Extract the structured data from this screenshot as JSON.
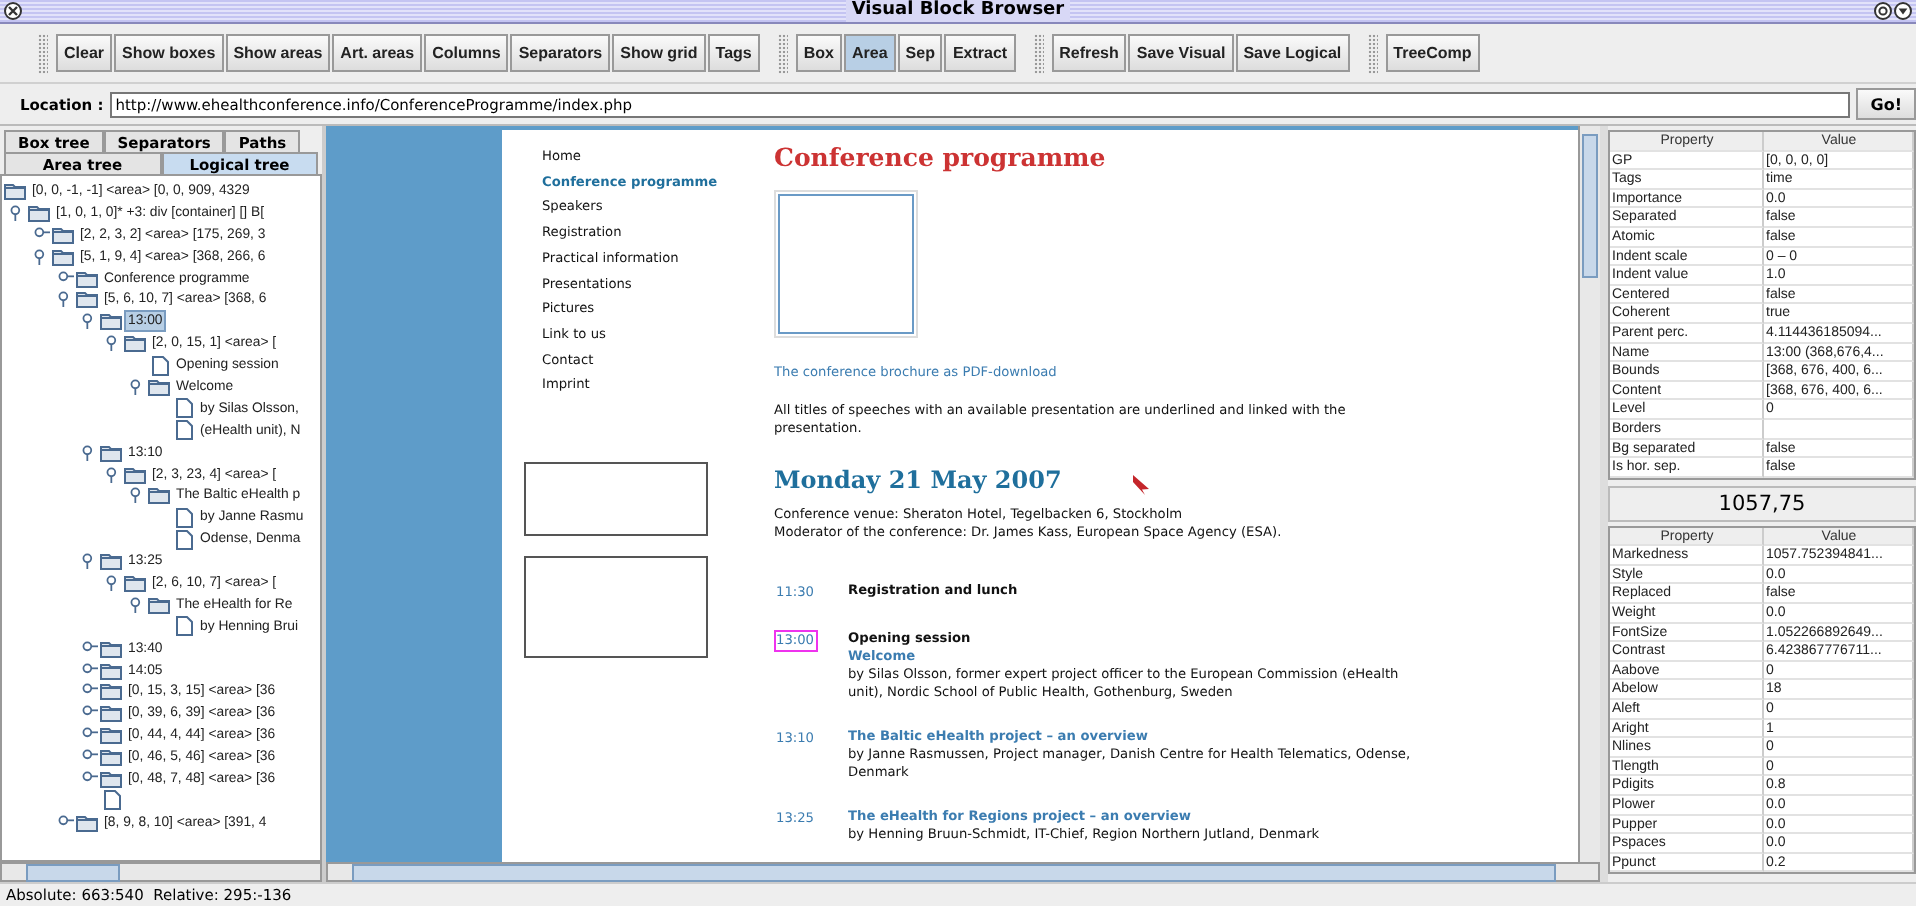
{
  "window": {
    "title": "Visual Block Browser"
  },
  "toolbar": {
    "groups": [
      {
        "buttons": [
          {
            "label": "Clear",
            "selected": false
          },
          {
            "label": "Show boxes",
            "selected": false
          },
          {
            "label": "Show areas",
            "selected": false
          },
          {
            "label": "Art. areas",
            "selected": false
          },
          {
            "label": "Columns",
            "selected": false
          },
          {
            "label": "Separators",
            "selected": false
          },
          {
            "label": "Show grid",
            "selected": false
          },
          {
            "label": "Tags",
            "selected": false
          }
        ]
      },
      {
        "buttons": [
          {
            "label": "Box",
            "selected": false
          },
          {
            "label": "Area",
            "selected": true
          },
          {
            "label": "Sep",
            "selected": false
          },
          {
            "label": "Extract",
            "selected": false
          }
        ]
      },
      {
        "buttons": [
          {
            "label": "Refresh",
            "selected": false
          },
          {
            "label": "Save Visual",
            "selected": false
          },
          {
            "label": "Save Logical",
            "selected": false
          }
        ]
      },
      {
        "buttons": [
          {
            "label": "TreeComp",
            "selected": false
          }
        ]
      }
    ]
  },
  "location": {
    "label": "Location :",
    "value": "http://www.ehealthconference.info/ConferenceProgramme/index.php",
    "go": "Go!"
  },
  "left_panel": {
    "tab_rows": [
      [
        {
          "label": "Box tree",
          "selected": false
        },
        {
          "label": "Separators",
          "selected": false
        },
        {
          "label": "Paths",
          "selected": false
        }
      ],
      [
        {
          "label": "Area tree",
          "selected": false
        },
        {
          "label": "Logical tree",
          "selected": true
        }
      ]
    ],
    "tree": [
      {
        "label": "[0, 0, -1, -1] <area> [0, 0, 909, 4329",
        "kind": "folder",
        "expanded": true,
        "selected": false,
        "children": [
          {
            "label": "[1, 0, 1, 0]* +3: div [container] [] B[",
            "kind": "folder",
            "expanded": true,
            "selected": false,
            "children": [
              {
                "label": "[2, 2, 3, 2] <area> [175, 269, 3",
                "kind": "folder",
                "expanded": false,
                "selected": false
              },
              {
                "label": "[5, 1, 9, 4] <area> [368, 266, 6",
                "kind": "folder",
                "expanded": true,
                "selected": false,
                "children": [
                  {
                    "label": "Conference programme",
                    "kind": "folder",
                    "expanded": false,
                    "selected": false
                  },
                  {
                    "label": "[5, 6, 10, 7] <area> [368, 6",
                    "kind": "folder",
                    "expanded": true,
                    "selected": false,
                    "children": [
                      {
                        "label": "13:00",
                        "kind": "folder",
                        "expanded": true,
                        "selected": true,
                        "children": [
                          {
                            "label": "[2, 0, 15, 1] <area> [",
                            "kind": "folder",
                            "expanded": true,
                            "selected": false,
                            "children": [
                              {
                                "label": "Opening session",
                                "kind": "leaf",
                                "selected": false
                              },
                              {
                                "label": "Welcome",
                                "kind": "folder",
                                "expanded": true,
                                "selected": false,
                                "children": [
                                  {
                                    "label": "by Silas Olsson,",
                                    "kind": "leaf",
                                    "selected": false
                                  },
                                  {
                                    "label": "(eHealth unit), N",
                                    "kind": "leaf",
                                    "selected": false
                                  }
                                ]
                              }
                            ]
                          }
                        ]
                      },
                      {
                        "label": "13:10",
                        "kind": "folder",
                        "expanded": true,
                        "selected": false,
                        "children": [
                          {
                            "label": "[2, 3, 23, 4] <area> [",
                            "kind": "folder",
                            "expanded": true,
                            "selected": false,
                            "children": [
                              {
                                "label": "The Baltic eHealth p",
                                "kind": "folder",
                                "expanded": true,
                                "selected": false,
                                "children": [
                                  {
                                    "label": "by Janne Rasmu",
                                    "kind": "leaf",
                                    "selected": false
                                  },
                                  {
                                    "label": "Odense, Denma",
                                    "kind": "leaf",
                                    "selected": false
                                  }
                                ]
                              }
                            ]
                          }
                        ]
                      },
                      {
                        "label": "13:25",
                        "kind": "folder",
                        "expanded": true,
                        "selected": false,
                        "children": [
                          {
                            "label": "[2, 6, 10, 7] <area> [",
                            "kind": "folder",
                            "expanded": true,
                            "selected": false,
                            "children": [
                              {
                                "label": "The eHealth for Re",
                                "kind": "folder",
                                "expanded": true,
                                "selected": false,
                                "children": [
                                  {
                                    "label": "by Henning Brui",
                                    "kind": "leaf",
                                    "selected": false
                                  }
                                ]
                              }
                            ]
                          }
                        ]
                      },
                      {
                        "label": "13:40",
                        "kind": "folder",
                        "expanded": false,
                        "selected": false
                      },
                      {
                        "label": "14:05",
                        "kind": "folder",
                        "expanded": false,
                        "selected": false
                      },
                      {
                        "label": "[0, 15, 3, 15] <area> [36",
                        "kind": "folder",
                        "expanded": false,
                        "selected": false
                      },
                      {
                        "label": "[0, 39, 6, 39] <area> [36",
                        "kind": "folder",
                        "expanded": false,
                        "selected": false
                      },
                      {
                        "label": "[0, 44, 4, 44] <area> [36",
                        "kind": "folder",
                        "expanded": false,
                        "selected": false
                      },
                      {
                        "label": "[0, 46, 5, 46] <area> [36",
                        "kind": "folder",
                        "expanded": false,
                        "selected": false
                      },
                      {
                        "label": "[0, 48, 7, 48] <area> [36",
                        "kind": "folder",
                        "expanded": false,
                        "selected": false
                      },
                      {
                        "kind": "leaf",
                        "selected": false
                      }
                    ]
                  },
                  {
                    "label": "[8, 9, 8, 10] <area> [391, 4",
                    "kind": "folder",
                    "expanded": false,
                    "selected": false
                  }
                ]
              }
            ]
          }
        ]
      }
    ]
  },
  "page": {
    "nav": [
      {
        "label": "Home",
        "selected": false
      },
      {
        "label": "Conference programme",
        "selected": true
      },
      {
        "label": "Speakers",
        "selected": false
      },
      {
        "label": "Registration",
        "selected": false
      },
      {
        "label": "Practical information",
        "selected": false
      },
      {
        "label": "Presentations",
        "selected": false
      },
      {
        "label": "Pictures",
        "selected": false
      },
      {
        "label": "Link to us",
        "selected": false
      },
      {
        "label": "Contact",
        "selected": false
      },
      {
        "label": "Imprint",
        "selected": false
      }
    ],
    "heading": "Conference programme",
    "brochure_link": "The conference brochure as PDF-download",
    "intro": "All titles of speeches with an available presentation are underlined and linked with the presentation.",
    "date_heading": "Monday 21 May 2007",
    "venue": "Conference venue: Sheraton Hotel, Tegelbacken 6, Stockholm",
    "moderator": "Moderator of the conference: Dr. James Kass, European Space Agency (ESA).",
    "schedule": [
      {
        "time": "11:30",
        "highlighted": false,
        "lines": [
          {
            "kind": "heading",
            "text": "Registration and lunch"
          }
        ]
      },
      {
        "time": "13:00",
        "highlighted": true,
        "lines": [
          {
            "kind": "heading",
            "text": "Opening session"
          },
          {
            "kind": "link",
            "text": "Welcome"
          },
          {
            "kind": "speaker",
            "text": "by Silas Olsson, former expert project officer to the European Commission (eHealth unit), Nordic School of Public Health, Gothenburg, Sweden"
          }
        ]
      },
      {
        "time": "13:10",
        "highlighted": false,
        "lines": [
          {
            "kind": "link",
            "text": "The Baltic eHealth project – an overview"
          },
          {
            "kind": "speaker",
            "text": "by Janne Rasmussen, Project manager, Danish Centre for Health Telematics, Odense, Denmark"
          }
        ]
      },
      {
        "time": "13:25",
        "highlighted": false,
        "lines": [
          {
            "kind": "link",
            "text": "The eHealth for Regions project – an overview"
          },
          {
            "kind": "speaker",
            "text": "by Henning Bruun-Schmidt, IT-Chief, Region Northern Jutland, Denmark"
          }
        ]
      }
    ]
  },
  "properties_top": {
    "columns": [
      "Property",
      "Value"
    ],
    "rows": [
      {
        "name": "GP",
        "value": "[0, 0, 0, 0]"
      },
      {
        "name": "Tags",
        "value": "time"
      },
      {
        "name": "Importance",
        "value": "0.0"
      },
      {
        "name": "Separated",
        "value": "false"
      },
      {
        "name": "Atomic",
        "value": "false"
      },
      {
        "name": "Indent scale",
        "value": "0 – 0"
      },
      {
        "name": "Indent value",
        "value": "1.0"
      },
      {
        "name": "Centered",
        "value": "false"
      },
      {
        "name": "Coherent",
        "value": "true"
      },
      {
        "name": "Parent perc.",
        "value": "4.114436185094..."
      },
      {
        "name": "Name",
        "value": "13:00 (368,676,4..."
      },
      {
        "name": "Bounds",
        "value": "[368, 676, 400, 6..."
      },
      {
        "name": "Content",
        "value": "[368, 676, 400, 6..."
      },
      {
        "name": "Level",
        "value": "0"
      },
      {
        "name": "Borders"
      },
      {
        "name": "Bg separated",
        "value": "false"
      },
      {
        "name": "Is hor. sep.",
        "value": "false"
      }
    ]
  },
  "markedness": "1057,75",
  "properties_bottom": {
    "columns": [
      "Property",
      "Value"
    ],
    "rows": [
      {
        "name": "Markedness",
        "value": "1057.752394841..."
      },
      {
        "name": "Style",
        "value": "0.0"
      },
      {
        "name": "Replaced",
        "value": "false"
      },
      {
        "name": "Weight",
        "value": "0.0"
      },
      {
        "name": "FontSize",
        "value": "1.052266892649..."
      },
      {
        "name": "Contrast",
        "value": "6.423867776711..."
      },
      {
        "name": "Aabove",
        "value": "0"
      },
      {
        "name": "Abelow",
        "value": "18"
      },
      {
        "name": "Aleft",
        "value": "0"
      },
      {
        "name": "Aright",
        "value": "1"
      },
      {
        "name": "Nlines",
        "value": "0"
      },
      {
        "name": "Tlength",
        "value": "0"
      },
      {
        "name": "Pdigits",
        "value": "0.8"
      },
      {
        "name": "Plower",
        "value": "0.0"
      },
      {
        "name": "Pupper",
        "value": "0.0"
      },
      {
        "name": "Pspaces",
        "value": "0.0"
      },
      {
        "name": "Ppunct",
        "value": "0.2"
      }
    ]
  },
  "status_bar": "Absolute: 663:540  Relative: 295:-136"
}
